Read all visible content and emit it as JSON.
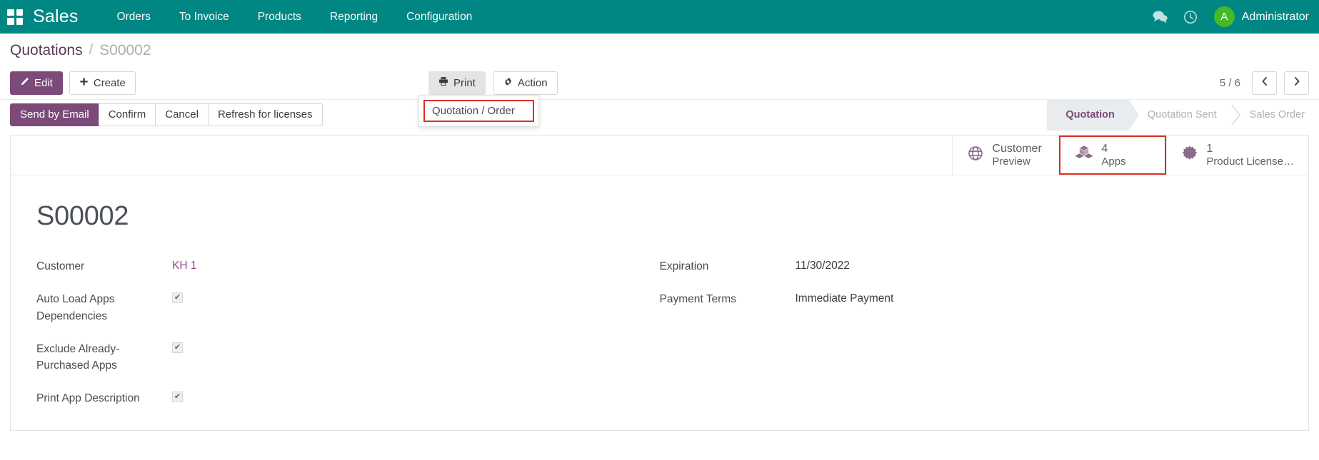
{
  "navbar": {
    "brand": "Sales",
    "apps_icon": "apps-grid-icon",
    "menu": [
      {
        "label": "Orders"
      },
      {
        "label": "To Invoice"
      },
      {
        "label": "Products"
      },
      {
        "label": "Reporting"
      },
      {
        "label": "Configuration"
      }
    ],
    "messages_icon": "chat-bubbles-icon",
    "activities_icon": "clock-icon",
    "user": {
      "initial": "A",
      "name": "Administrator"
    },
    "background_color": "#008784",
    "avatar_color": "#46b929"
  },
  "breadcrumb": {
    "parent": "Quotations",
    "separator": "/",
    "current": "S00002"
  },
  "control_panel": {
    "edit_label": "Edit",
    "create_label": "Create",
    "print_label": "Print",
    "action_label": "Action",
    "print_icon": "printer-icon",
    "action_icon": "gear-icon",
    "edit_icon": "pencil-icon",
    "create_icon": "plus-icon",
    "pager_text": "5 / 6",
    "prev_icon": "chevron-left-icon",
    "next_icon": "chevron-right-icon",
    "dropdown": {
      "open": true,
      "items": [
        {
          "label": "Quotation / Order",
          "highlighted": true
        }
      ],
      "highlight_color": "#d93025"
    },
    "workflow_buttons": [
      {
        "label": "Send by Email",
        "primary": true
      },
      {
        "label": "Confirm",
        "primary": false
      },
      {
        "label": "Cancel",
        "primary": false
      },
      {
        "label": "Refresh for licenses",
        "primary": false
      }
    ],
    "statusbar": [
      {
        "label": "Quotation",
        "active": true
      },
      {
        "label": "Quotation Sent",
        "active": false
      },
      {
        "label": "Sales Order",
        "active": false
      }
    ]
  },
  "sheet": {
    "stat_buttons": [
      {
        "icon": "globe-icon",
        "value": "Customer",
        "label": "Preview",
        "two_line_label": true,
        "highlighted": false
      },
      {
        "icon": "apps-boxes-icon",
        "value": "4",
        "label": "Apps",
        "highlighted": true
      },
      {
        "icon": "gear-badge-icon",
        "value": "1",
        "label": "Product License…",
        "highlighted": false
      }
    ],
    "record_title": "S00002",
    "left_fields": [
      {
        "label": "Customer",
        "type": "link",
        "value": "KH 1"
      },
      {
        "label": "Auto Load Apps Dependencies",
        "type": "checkbox",
        "checked": true
      },
      {
        "label": "Exclude Already-Purchased Apps",
        "type": "checkbox",
        "checked": true
      },
      {
        "label": "Print App Description",
        "type": "checkbox",
        "checked": true
      }
    ],
    "right_fields": [
      {
        "label": "Expiration",
        "type": "text",
        "value": "11/30/2022"
      },
      {
        "label": "Payment Terms",
        "type": "text",
        "value": "Immediate Payment"
      }
    ]
  }
}
